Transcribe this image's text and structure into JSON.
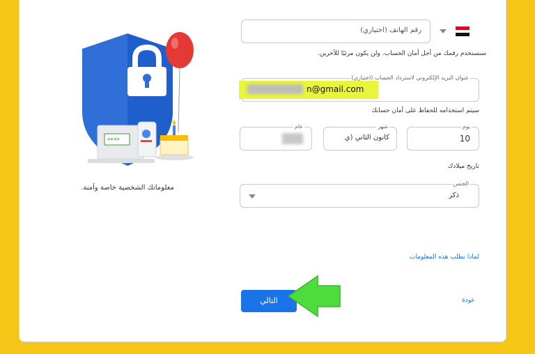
{
  "phone": {
    "placeholder": "رقم الهاتف (اختياري)"
  },
  "phone_note": "سنستخدم رقمك من أجل أمان الحساب. ولن يكون مرئيًا للآخرين.",
  "recovery_email": {
    "label": "عنوان البريد الإلكتروني لاسترداد الحساب (اختياري)",
    "value": "n@gmail.com"
  },
  "email_note": "سيتم استخدامه للحفاظ على أمان حسابك",
  "birthday": {
    "title": "تاريخ ميلادك",
    "day_label": "يوم",
    "day_value": "10",
    "month_label": "شهر",
    "month_value": "كانون الثاني (ي",
    "year_label": "عام"
  },
  "gender": {
    "label": "الجنس",
    "value": "ذكر"
  },
  "why_link": "لماذا نطلب هذه المعلومات",
  "next_button": "التالي",
  "back_link": "عودة",
  "privacy_caption": "معلوماتك الشخصية خاصة وآمنة.",
  "colors": {
    "accent": "#1a73e8",
    "frame": "#f5c518",
    "highlight": "#e9f53a",
    "arrow": "#4cdc3c"
  }
}
